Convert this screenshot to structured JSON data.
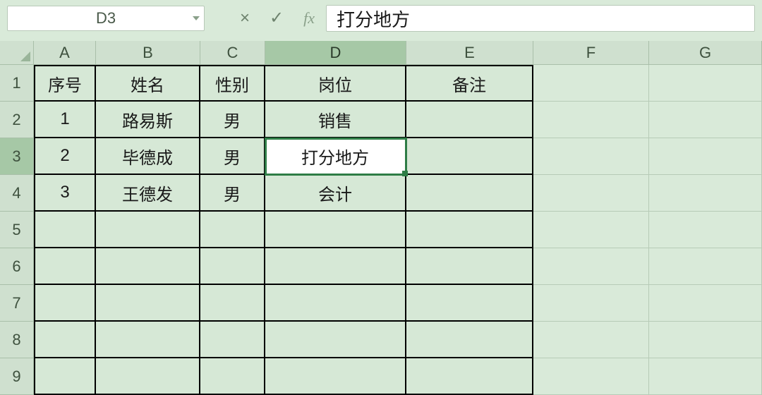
{
  "formula_bar": {
    "name_box": "D3",
    "cancel_icon": "×",
    "accept_icon": "✓",
    "fx_label": "fx",
    "formula_value": "打分地方"
  },
  "active_cell": {
    "row": 3,
    "col": "D"
  },
  "columns": [
    "A",
    "B",
    "C",
    "D",
    "E",
    "F",
    "G"
  ],
  "rows": [
    "1",
    "2",
    "3",
    "4",
    "5",
    "6",
    "7",
    "8",
    "9"
  ],
  "table": {
    "headers": {
      "A": "序号",
      "B": "姓名",
      "C": "性别",
      "D": "岗位",
      "E": "备注"
    },
    "r2": {
      "A": "1",
      "B": "路易斯",
      "C": "男",
      "D": "销售",
      "E": ""
    },
    "r3": {
      "A": "2",
      "B": "毕德成",
      "C": "男",
      "D": "打分地方",
      "E": ""
    },
    "r4": {
      "A": "3",
      "B": "王德发",
      "C": "男",
      "D": "会计",
      "E": ""
    }
  }
}
